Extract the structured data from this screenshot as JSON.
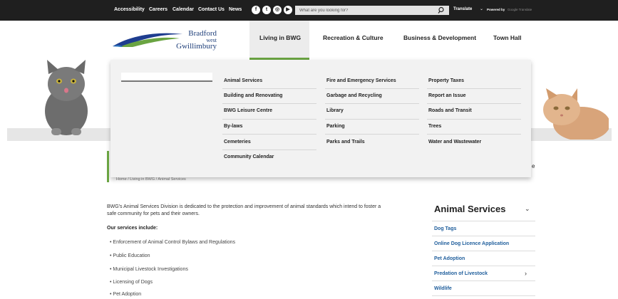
{
  "utility_bar": {
    "links": [
      "Accessibility",
      "Careers",
      "Calendar",
      "Contact Us",
      "News"
    ],
    "social_icons": [
      "facebook-icon",
      "twitter-icon",
      "instagram-icon",
      "youtube-icon"
    ],
    "search_placeholder": "What are you looking for?",
    "translate_label": "Translate",
    "powered_by": "Powered by",
    "powered_logo": "Google Translate"
  },
  "logo": {
    "line1": "Bradford",
    "line2": "west",
    "line3": "Gwillimbury"
  },
  "nav": [
    "Living in BWG",
    "Recreation & Culture",
    "Business & Development",
    "Town Hall"
  ],
  "mega_menu": {
    "col1": [
      "Animal Services",
      "Building and Renovating",
      "BWG Leisure Centre",
      "By-laws",
      "Cemeteries",
      "Community Calendar"
    ],
    "col2": [
      "Fire and Emergency Services",
      "Garbage and Recycling",
      "Library",
      "Parking",
      "Parks and Trails"
    ],
    "col3": [
      "Property Taxes",
      "Report an Issue",
      "Roads and Transit",
      "Trees",
      "Water and Wastewater"
    ]
  },
  "breadcrumb": "Home  /  Living in BWG  /  Animal Services",
  "ghost_text": "e",
  "content": {
    "intro_line1": "BWG's Animal Services Division is dedicated to the protection and improvement of animal standards which intend to foster a",
    "intro_line2": "safe community for pets and their owners.",
    "services_heading": "Our services include:",
    "services": [
      "Enforcement of Animal Control Bylaws and Regulations",
      "Public Education",
      "Municipal Livestock Investigations",
      "Licensing of Dogs",
      "Pet Adoption"
    ]
  },
  "sidebar": {
    "title": "Animal Services",
    "links": [
      "Dog Tags",
      "Online Dog Licence Application",
      "Pet Adoption",
      "Predation of Livestock",
      "Wildlife"
    ]
  },
  "colors": {
    "accent_green": "#6aa442",
    "link_blue": "#1f5e9c",
    "topbar": "#1f1f1f"
  }
}
